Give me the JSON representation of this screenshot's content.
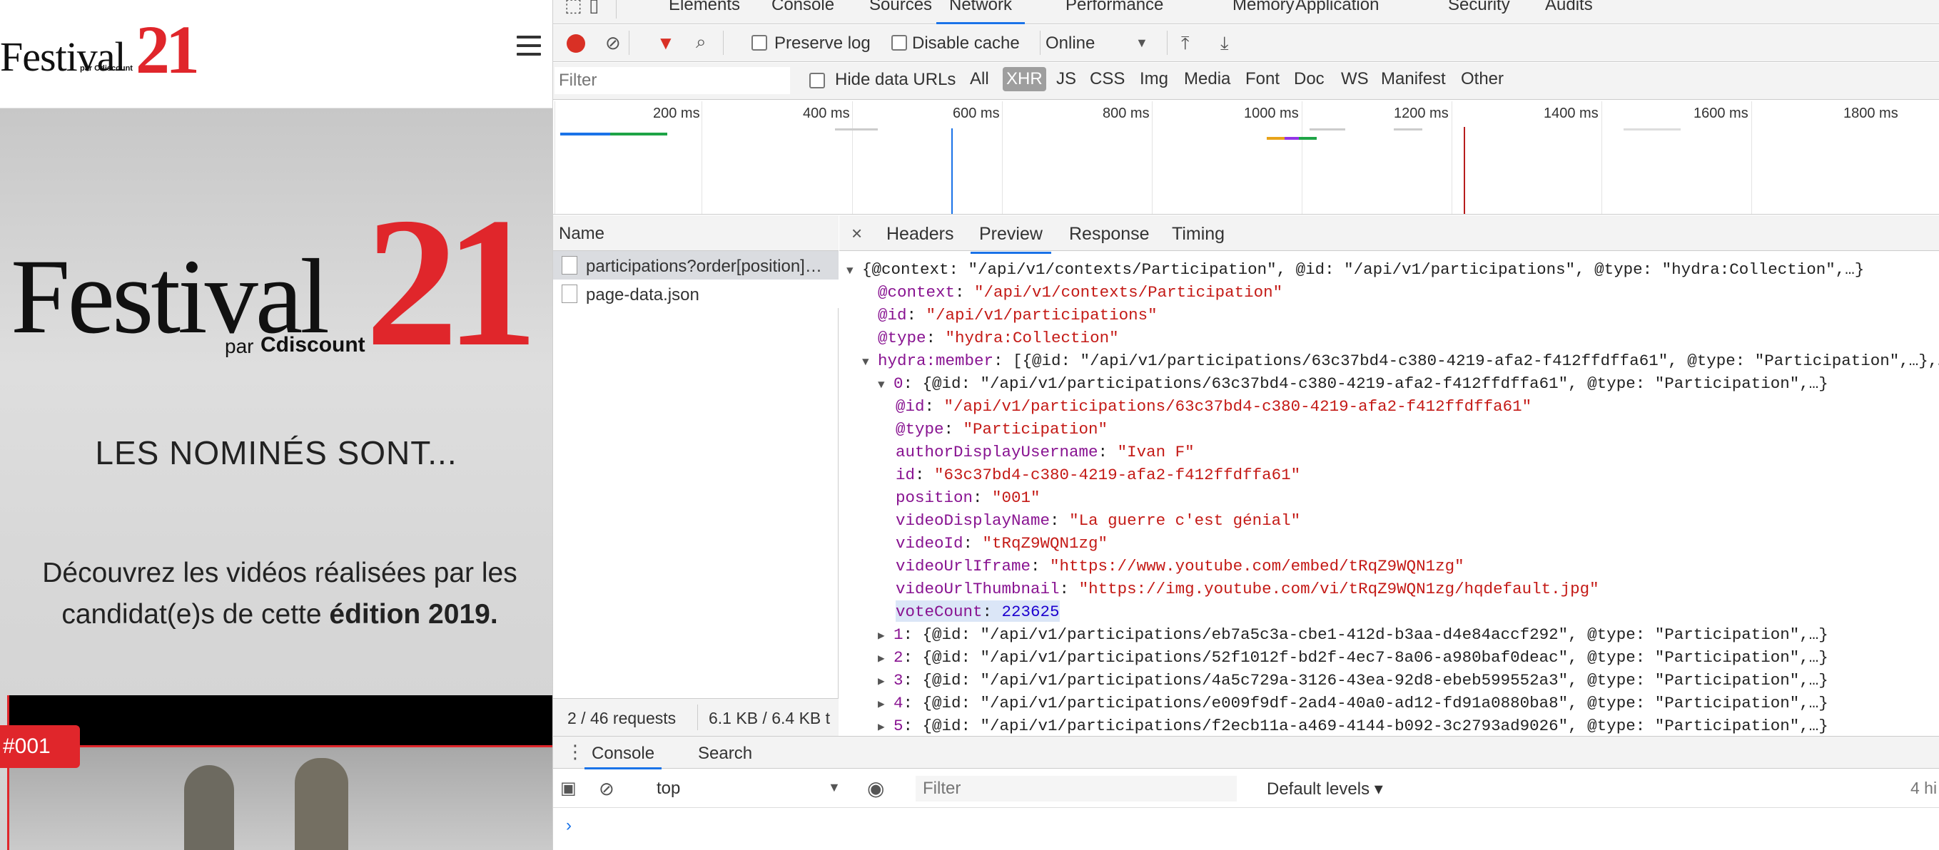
{
  "site": {
    "header_logo": {
      "word": "Festival",
      "number": "21",
      "sub": "par Cdiscount"
    },
    "hero_logo": {
      "word": "Festival",
      "number": "21",
      "sub_prefix": "par",
      "sub_brand": "Cdiscount"
    },
    "nominees_heading": "LES NOMINÉS SONT...",
    "discover_text_line1": "Découvrez les vidéos réalisées par les",
    "discover_text_line2": "candidat(e)s de cette",
    "discover_text_bold": "édition 2019.",
    "badge": "#001"
  },
  "devtools": {
    "main_tabs": [
      "Elements",
      "Console",
      "Sources",
      "Network",
      "Performance",
      "Memory",
      "Application",
      "Security",
      "Audits"
    ],
    "active_tab": "Network",
    "toolbar": {
      "preserve_log": "Preserve log",
      "disable_cache": "Disable cache",
      "throttle": "Online"
    },
    "filter": {
      "placeholder": "Filter",
      "hide_data_urls": "Hide data URLs",
      "types": [
        "All",
        "XHR",
        "JS",
        "CSS",
        "Img",
        "Media",
        "Font",
        "Doc",
        "WS",
        "Manifest",
        "Other"
      ],
      "active_type": "XHR"
    },
    "timeline_ticks": [
      "200 ms",
      "400 ms",
      "600 ms",
      "800 ms",
      "1000 ms",
      "1200 ms",
      "1400 ms",
      "1600 ms",
      "1800 ms"
    ],
    "requests": {
      "header": "Name",
      "items": [
        "participations?order[position]…",
        "page-data.json"
      ],
      "status": "2 / 46 requests",
      "size": "6.1 KB / 6.4 KB t"
    },
    "detail_tabs": [
      "Headers",
      "Preview",
      "Response",
      "Timing"
    ],
    "active_detail_tab": "Preview",
    "preview": {
      "root_summary": "{@context: \"/api/v1/contexts/Participation\", @id: \"/api/v1/participations\", @type: \"hydra:Collection\",…}",
      "context_key": "@context",
      "context_val": "\"/api/v1/contexts/Participation\"",
      "id_key": "@id",
      "id_val": "\"/api/v1/participations\"",
      "type_key": "@type",
      "type_val": "\"hydra:Collection\"",
      "member_key": "hydra:member",
      "member_summary": "[{@id: \"/api/v1/participations/63c37bd4-c380-4219-afa2-f412ffdffa61\", @type: \"Participation\",…},…]",
      "item0_key": "0",
      "item0_summary": "{@id: \"/api/v1/participations/63c37bd4-c380-4219-afa2-f412ffdffa61\", @type: \"Participation\",…}",
      "fields": [
        {
          "k": "@id",
          "v": "\"/api/v1/participations/63c37bd4-c380-4219-afa2-f412ffdffa61\"",
          "t": "s"
        },
        {
          "k": "@type",
          "v": "\"Participation\"",
          "t": "s"
        },
        {
          "k": "authorDisplayUsername",
          "v": "\"Ivan F\"",
          "t": "s"
        },
        {
          "k": "id",
          "v": "\"63c37bd4-c380-4219-afa2-f412ffdffa61\"",
          "t": "s"
        },
        {
          "k": "position",
          "v": "\"001\"",
          "t": "s"
        },
        {
          "k": "videoDisplayName",
          "v": "\"La guerre c'est génial\"",
          "t": "s"
        },
        {
          "k": "videoId",
          "v": "\"tRqZ9WQN1zg\"",
          "t": "s"
        },
        {
          "k": "videoUrlIframe",
          "v": "\"https://www.youtube.com/embed/tRqZ9WQN1zg\"",
          "t": "s"
        },
        {
          "k": "videoUrlThumbnail",
          "v": "\"https://img.youtube.com/vi/tRqZ9WQN1zg/hqdefault.jpg\"",
          "t": "s"
        },
        {
          "k": "voteCount",
          "v": "223625",
          "t": "n"
        }
      ],
      "collapsed": [
        {
          "k": "1",
          "v": "{@id: \"/api/v1/participations/eb7a5c3a-cbe1-412d-b3aa-d4e84accf292\", @type: \"Participation\",…}"
        },
        {
          "k": "2",
          "v": "{@id: \"/api/v1/participations/52f1012f-bd2f-4ec7-8a06-a980baf0deac\", @type: \"Participation\",…}"
        },
        {
          "k": "3",
          "v": "{@id: \"/api/v1/participations/4a5c729a-3126-43ea-92d8-ebeb599552a3\", @type: \"Participation\",…}"
        },
        {
          "k": "4",
          "v": "{@id: \"/api/v1/participations/e009f9df-2ad4-40a0-ad12-fd91a0880ba8\", @type: \"Participation\",…}"
        },
        {
          "k": "5",
          "v": "{@id: \"/api/v1/participations/f2ecb11a-a469-4144-b092-3c2793ad9026\", @type: \"Participation\",…}"
        }
      ]
    },
    "drawer": {
      "tabs": [
        "Console",
        "Search"
      ],
      "context": "top",
      "filter_placeholder": "Filter",
      "levels": "Default levels ▾",
      "hidden": "4 hi"
    }
  }
}
